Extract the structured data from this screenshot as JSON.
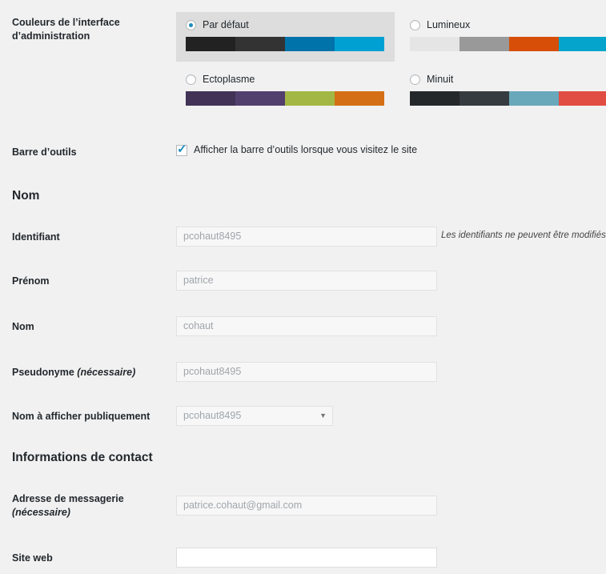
{
  "admin_colors": {
    "label_line1": "Couleurs de l’interface",
    "label_line2": "d’administration",
    "schemes": [
      {
        "name": "Par défaut",
        "selected": true,
        "colors": [
          "#222222",
          "#333333",
          "#0073aa",
          "#00a0d2"
        ]
      },
      {
        "name": "Lumineux",
        "selected": false,
        "colors": [
          "#e5e5e5",
          "#999999",
          "#d64e07",
          "#04a4cc"
        ]
      },
      {
        "name": "Ectoplasme",
        "selected": false,
        "colors": [
          "#413256",
          "#523f6d",
          "#a3b745",
          "#d46f15"
        ]
      },
      {
        "name": "Minuit",
        "selected": false,
        "colors": [
          "#25282b",
          "#363b3f",
          "#69a8bb",
          "#e14d43"
        ]
      }
    ]
  },
  "toolbar": {
    "label": "Barre d’outils",
    "checkbox_label": "Afficher la barre d’outils lorsque vous visitez le site",
    "checked": true
  },
  "name_section": {
    "title": "Nom",
    "username_label": "Identifiant",
    "username_value": "pcohaut8495",
    "username_note": "Les identifiants ne peuvent être modifiés.",
    "firstname_label": "Prénom",
    "firstname_value": "patrice",
    "lastname_label": "Nom",
    "lastname_value": "cohaut",
    "nickname_label": "Pseudonyme",
    "nickname_required": "(nécessaire)",
    "nickname_value": "pcohaut8495",
    "display_label": "Nom à afficher publiquement",
    "display_value": "pcohaut8495"
  },
  "contact_section": {
    "title": "Informations de contact",
    "email_label": "Adresse de messagerie",
    "email_required": "(nécessaire)",
    "email_value": "patrice.cohaut@gmail.com",
    "website_label": "Site web",
    "website_value": ""
  }
}
